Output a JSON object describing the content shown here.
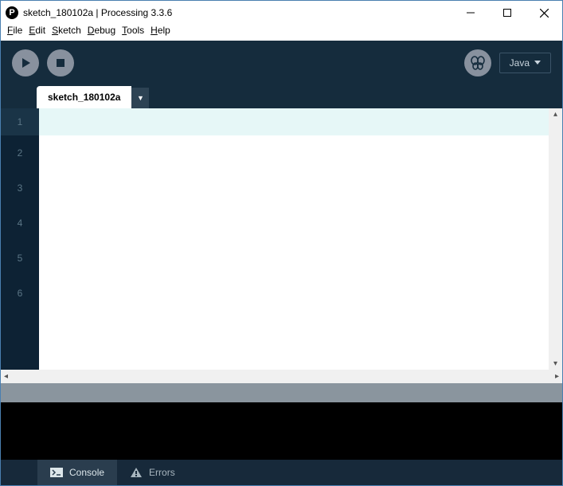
{
  "window": {
    "title": "sketch_180102a | Processing 3.3.6",
    "app_icon_letter": "P"
  },
  "menu": {
    "file": "File",
    "edit": "Edit",
    "sketch": "Sketch",
    "debug": "Debug",
    "tools": "Tools",
    "help": "Help"
  },
  "toolbar": {
    "mode_label": "Java"
  },
  "tab": {
    "name": "sketch_180102a",
    "dropdown_glyph": "▼"
  },
  "gutter": {
    "lines": [
      "1",
      "2",
      "3",
      "4",
      "5",
      "6"
    ]
  },
  "bottom": {
    "console": "Console",
    "errors": "Errors"
  }
}
